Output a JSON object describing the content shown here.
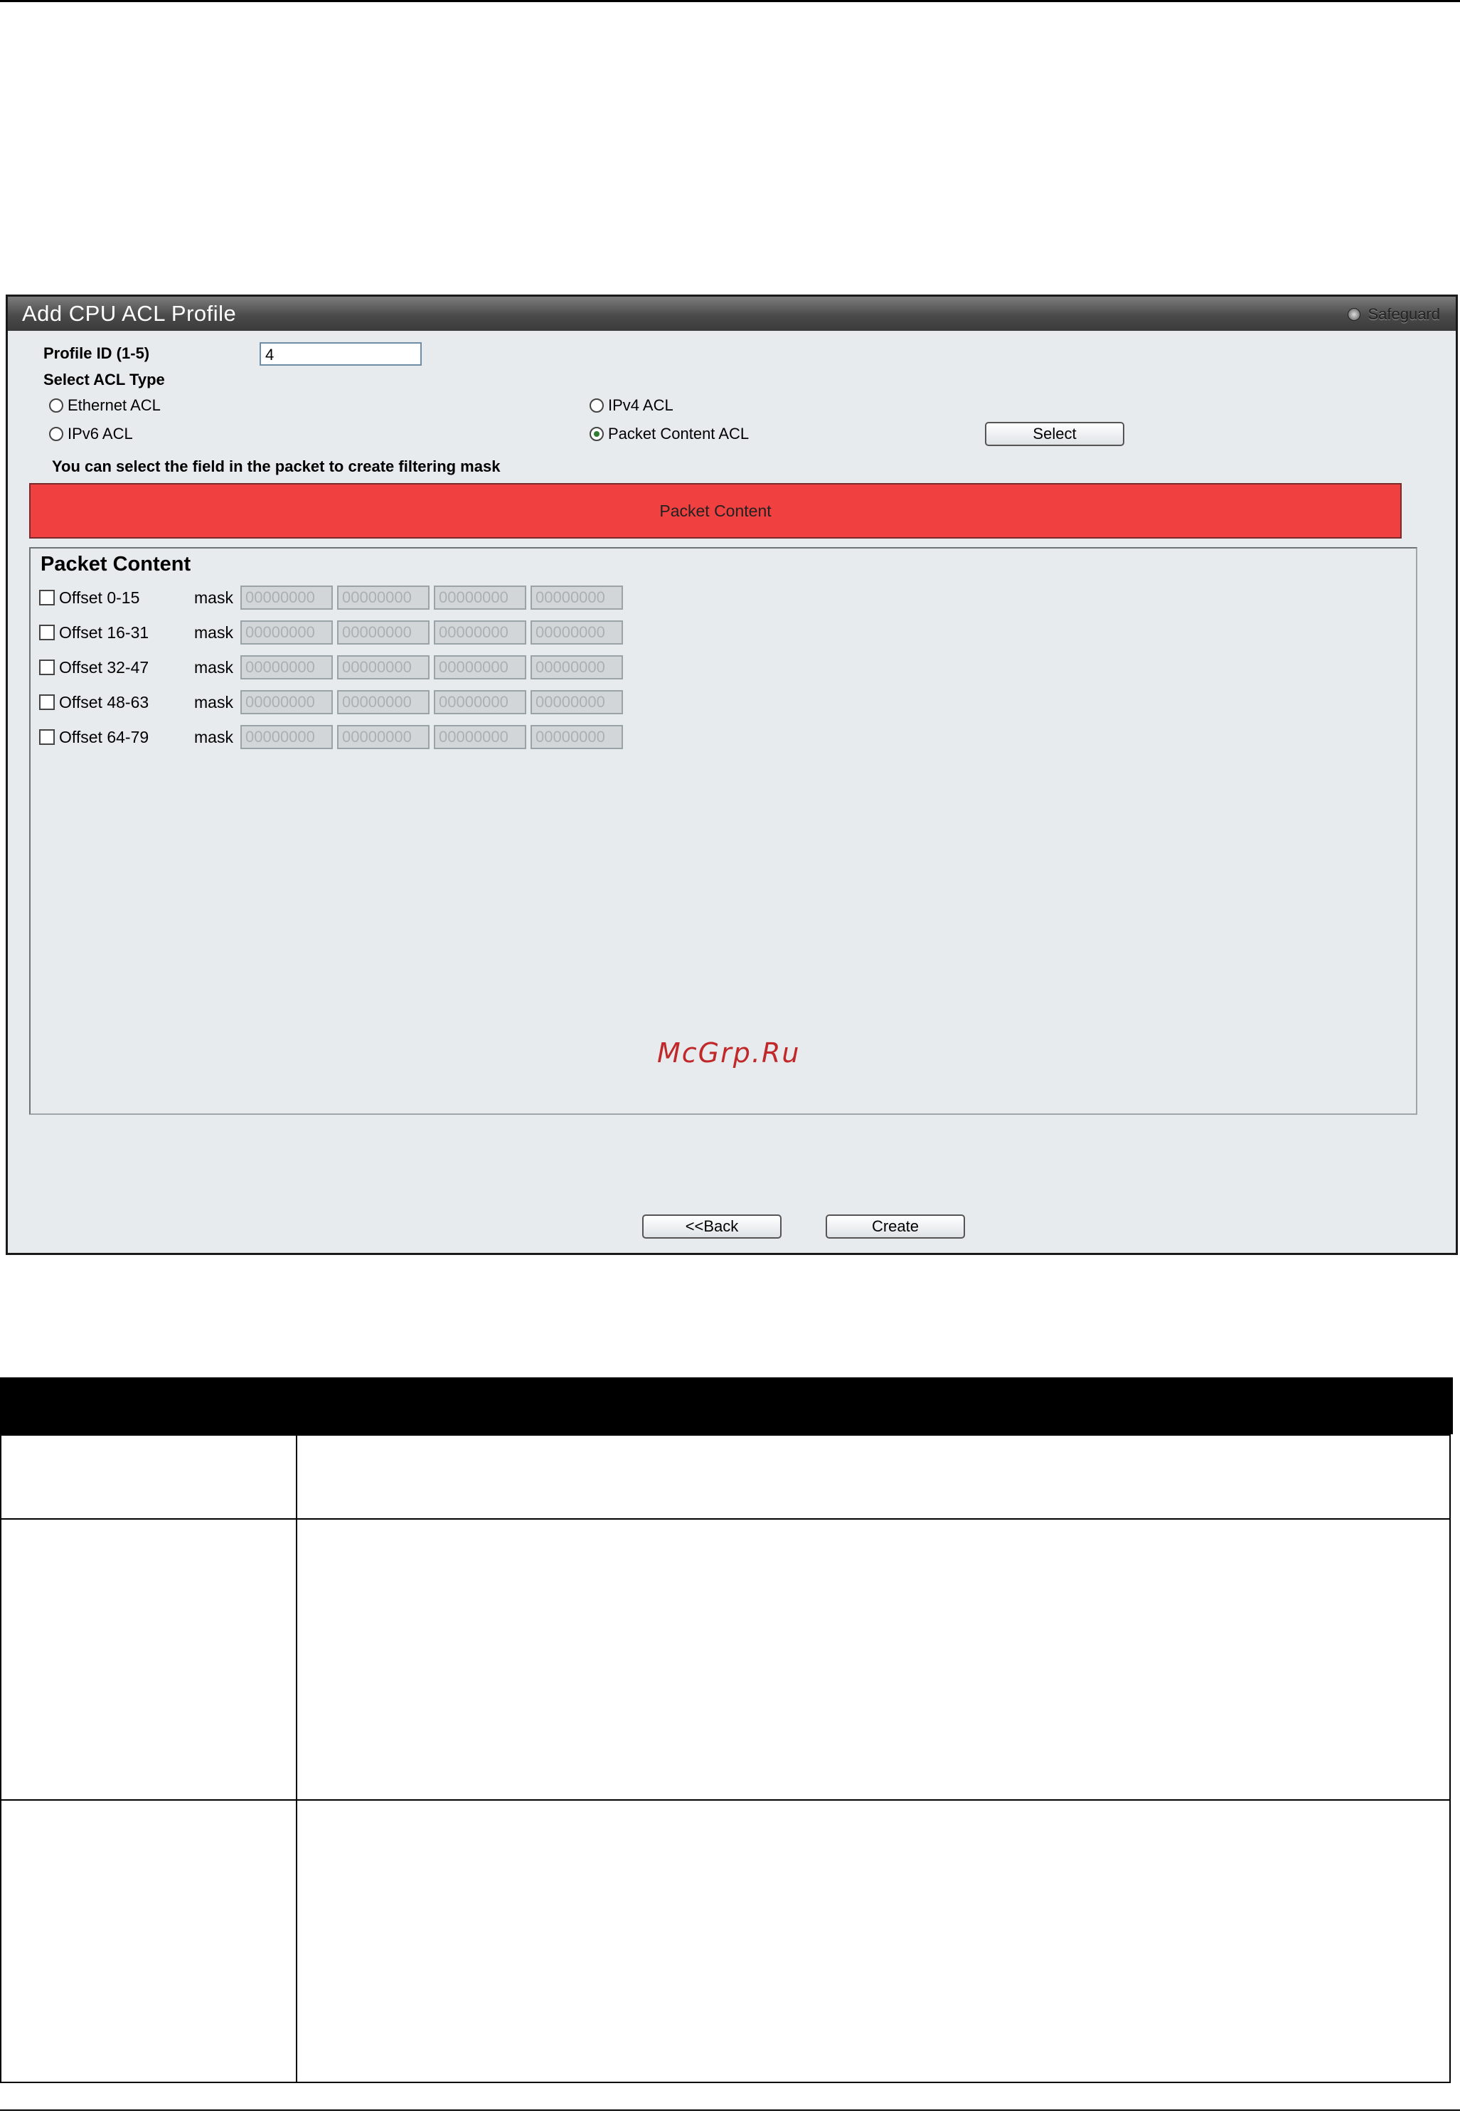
{
  "window": {
    "title": "Add CPU ACL Profile",
    "safeguard_label": "Safeguard"
  },
  "form": {
    "profile_id_label": "Profile ID (1-5)",
    "profile_id_value": "4",
    "select_acl_type_label": "Select ACL Type",
    "acl_types": [
      {
        "label": "Ethernet ACL",
        "selected": false
      },
      {
        "label": "IPv4 ACL",
        "selected": false
      },
      {
        "label": "IPv6 ACL",
        "selected": false
      },
      {
        "label": "Packet Content ACL",
        "selected": true
      }
    ],
    "select_button": "Select",
    "hint": "You can select the field in the packet to create filtering mask",
    "packet_content_bar": "Packet Content"
  },
  "packet_content": {
    "title": "Packet Content",
    "mask_label": "mask",
    "mask_placeholder": "00000000",
    "offsets": [
      {
        "label": "Offset 0-15",
        "checked": false
      },
      {
        "label": "Offset 16-31",
        "checked": false
      },
      {
        "label": "Offset 32-47",
        "checked": false
      },
      {
        "label": "Offset 48-63",
        "checked": false
      },
      {
        "label": "Offset 64-79",
        "checked": false
      }
    ]
  },
  "buttons": {
    "back": "<<Back",
    "create": "Create"
  },
  "watermark": "McGrp.Ru",
  "colors": {
    "title_bar": "#4b4b4b",
    "panel_bg": "#e7ebed",
    "red_bar": "#f04040",
    "watermark": "#c0282a"
  }
}
